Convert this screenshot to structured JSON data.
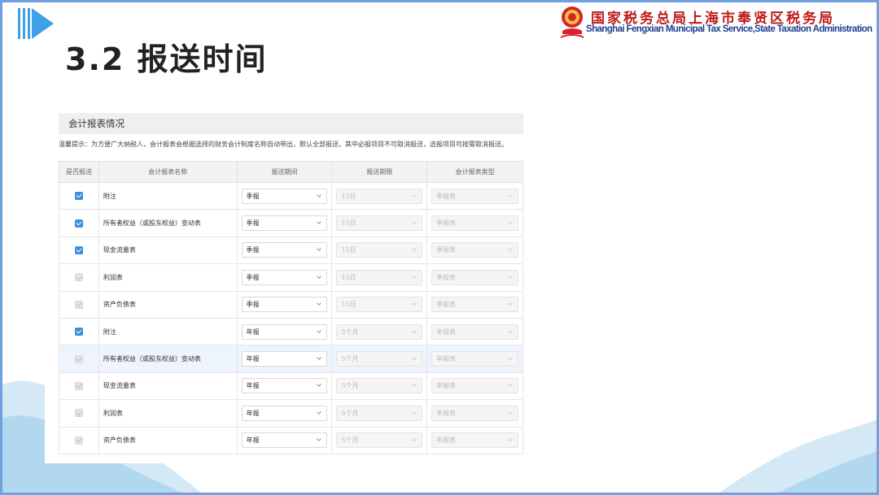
{
  "slide": {
    "title": "3.2 报送时间"
  },
  "header": {
    "org_cn": "国家税务总局上海市奉贤区税务局",
    "org_en": "Shanghai Fengxian Municipal Tax Service,State Taxation Administration",
    "logo_icon": "tax-emblem-icon"
  },
  "section": {
    "title": "会计报表情况",
    "tip": "温馨提示：为方便广大纳税人，会计报表会根据选择的财务会计制度名称自动带出，默认全部报送，其中必报项目不可取消报送，选报项目可按需取消报送。"
  },
  "table": {
    "headers": {
      "check": "是否报送",
      "name": "会计报表名称",
      "period": "报送期间",
      "deadline": "报送期限",
      "type": "会计报表类型"
    },
    "rows": [
      {
        "name": "附注",
        "period": "季报",
        "deadline": "15日",
        "type": "季报表"
      },
      {
        "name": "所有者权益（或股东权益）变动表",
        "period": "季报",
        "deadline": "15日",
        "type": "季报表"
      },
      {
        "name": "现金流量表",
        "period": "季报",
        "deadline": "15日",
        "type": "季报表"
      },
      {
        "name": "利润表",
        "period": "季报",
        "deadline": "15日",
        "type": "季报表"
      },
      {
        "name": "资产负债表",
        "period": "季报",
        "deadline": "15日",
        "type": "季报表"
      },
      {
        "name": "附注",
        "period": "年报",
        "deadline": "5个月",
        "type": "年报表"
      },
      {
        "name": "所有者权益（或股东权益）变动表",
        "period": "年报",
        "deadline": "5个月",
        "type": "年报表"
      },
      {
        "name": "现金流量表",
        "period": "年报",
        "deadline": "5个月",
        "type": "年报表"
      },
      {
        "name": "利润表",
        "period": "年报",
        "deadline": "5个月",
        "type": "年报表"
      },
      {
        "name": "资产负债表",
        "period": "年报",
        "deadline": "5个月",
        "type": "年报表"
      }
    ],
    "checked": [
      true,
      true,
      true,
      false,
      false,
      true,
      false,
      false,
      false,
      false
    ],
    "highlighted_row": 6
  },
  "colors": {
    "accent": "#3b8fe0",
    "frame": "#6fa0e0",
    "org_cn": "#c01a1a",
    "org_en": "#1e3f8e"
  }
}
